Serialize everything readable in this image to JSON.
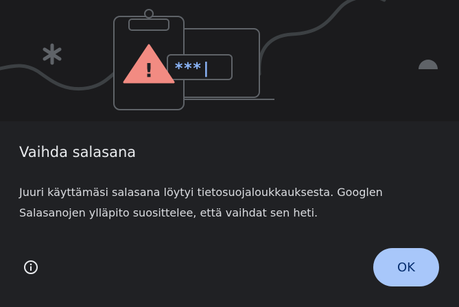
{
  "dialog": {
    "title": "Vaihda salasana",
    "message": "Juuri käyttämäsi salasana löytyi tietosuojaloukkauksesta. Googlen Salasanojen ylläpito suosittelee, että vaihdat sen heti.",
    "ok_label": "OK",
    "info_icon": "info-icon"
  },
  "illustration": {
    "warning_symbol": "!",
    "password_mask": "***|",
    "colors": {
      "warning": "#f28b82",
      "mask": "#8ab4f8",
      "outline": "#5f6368"
    }
  },
  "colors": {
    "background": "#202124",
    "illustration_bg": "#1b1b1d",
    "button_bg": "#a8c7fa",
    "button_text": "#062e6f"
  }
}
